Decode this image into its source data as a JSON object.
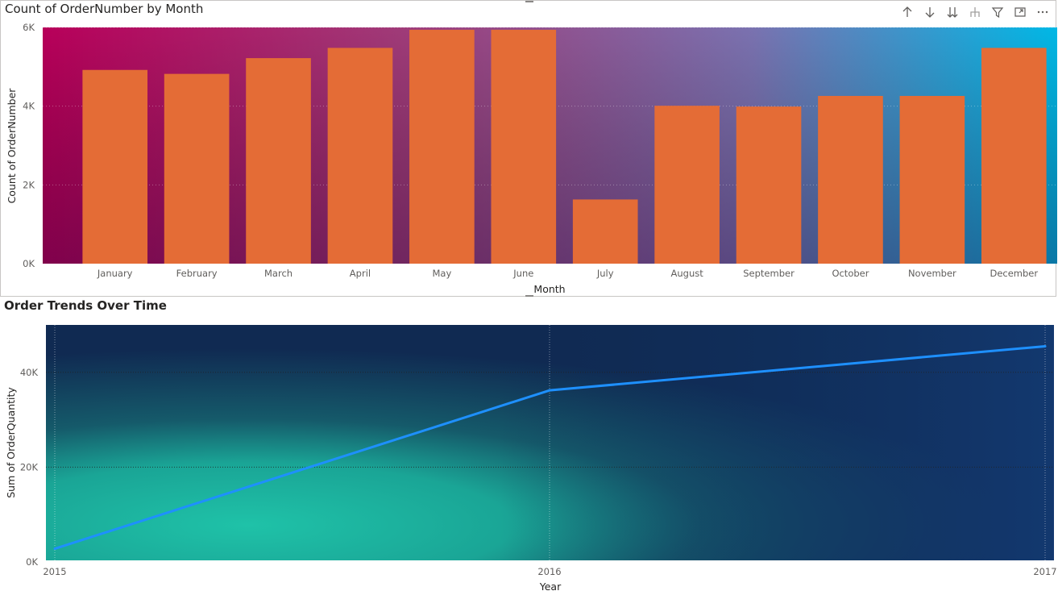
{
  "visuals": [
    {
      "title": "Count of OrderNumber by Month",
      "toolbar": [
        "drill-up-icon",
        "drill-down-icon",
        "expand-all-icon",
        "hierarchy-icon",
        "filter-icon",
        "focus-mode-icon",
        "more-options-icon"
      ]
    },
    {
      "title": "Order Trends Over Time"
    }
  ],
  "colors": {
    "bar": "#e46c36",
    "line": "#1e90ff",
    "grid": "#4a4a4a"
  },
  "chart_data": [
    {
      "type": "bar",
      "title": "Count of OrderNumber by Month",
      "xlabel": "Month",
      "ylabel": "Count of OrderNumber",
      "categories": [
        "January",
        "February",
        "March",
        "April",
        "May",
        "June",
        "July",
        "August",
        "September",
        "October",
        "November",
        "December"
      ],
      "values": [
        4920,
        4820,
        5220,
        5480,
        5940,
        5940,
        1630,
        4010,
        3990,
        4260,
        4260,
        5480
      ],
      "ylim": [
        0,
        6000
      ],
      "yticks": [
        0,
        2000,
        4000,
        6000
      ],
      "ytick_labels": [
        "0K",
        "2K",
        "4K",
        "6K"
      ],
      "grid": true
    },
    {
      "type": "line",
      "title": "Order Trends Over Time",
      "xlabel": "Year",
      "ylabel": "Sum of OrderQuantity",
      "x": [
        2015,
        2016,
        2017
      ],
      "series": [
        {
          "values": [
            2800,
            36200,
            45500
          ]
        }
      ],
      "xtick_labels": [
        "2015",
        "2016",
        "2017"
      ],
      "ylim": [
        0,
        50000
      ],
      "yticks": [
        0,
        20000,
        40000
      ],
      "ytick_labels": [
        "0K",
        "20K",
        "40K"
      ],
      "grid": true
    }
  ]
}
